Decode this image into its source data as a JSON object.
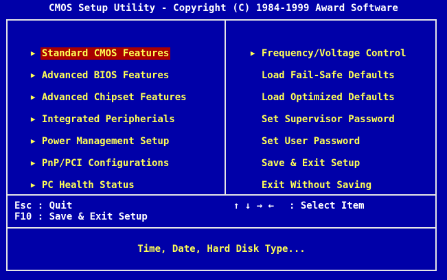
{
  "title": "CMOS Setup Utility - Copyright (C) 1984-1999 Award Software",
  "left_menu": [
    {
      "label": "Standard CMOS Features",
      "arrow": "▶",
      "selected": true
    },
    {
      "label": "Advanced BIOS Features",
      "arrow": "▶"
    },
    {
      "label": "Advanced Chipset Features",
      "arrow": "▶"
    },
    {
      "label": "Integrated Peripherials",
      "arrow": "▶"
    },
    {
      "label": "Power Management Setup",
      "arrow": "▶"
    },
    {
      "label": "PnP/PCI Configurations",
      "arrow": "▶"
    },
    {
      "label": "PC Health Status",
      "arrow": "▶"
    }
  ],
  "right_menu": [
    {
      "label": "Frequency/Voltage Control",
      "arrow": "▶"
    },
    {
      "label": "Load Fail-Safe Defaults",
      "arrow": ""
    },
    {
      "label": "Load Optimized Defaults",
      "arrow": ""
    },
    {
      "label": "Set Supervisor Password",
      "arrow": ""
    },
    {
      "label": "Set User Password",
      "arrow": ""
    },
    {
      "label": "Save & Exit Setup",
      "arrow": ""
    },
    {
      "label": "Exit Without Saving",
      "arrow": ""
    }
  ],
  "help": {
    "esc": "Esc : Quit",
    "f10": "F10 : Save & Exit Setup",
    "arrows": "↑ ↓ → ←",
    "select": ": Select Item"
  },
  "status": "Time, Date, Hard Disk Type...",
  "colors": {
    "background": "#0000a8",
    "text": "#ffff55",
    "selection": "#a80000",
    "frame": "#e6e6e6"
  }
}
